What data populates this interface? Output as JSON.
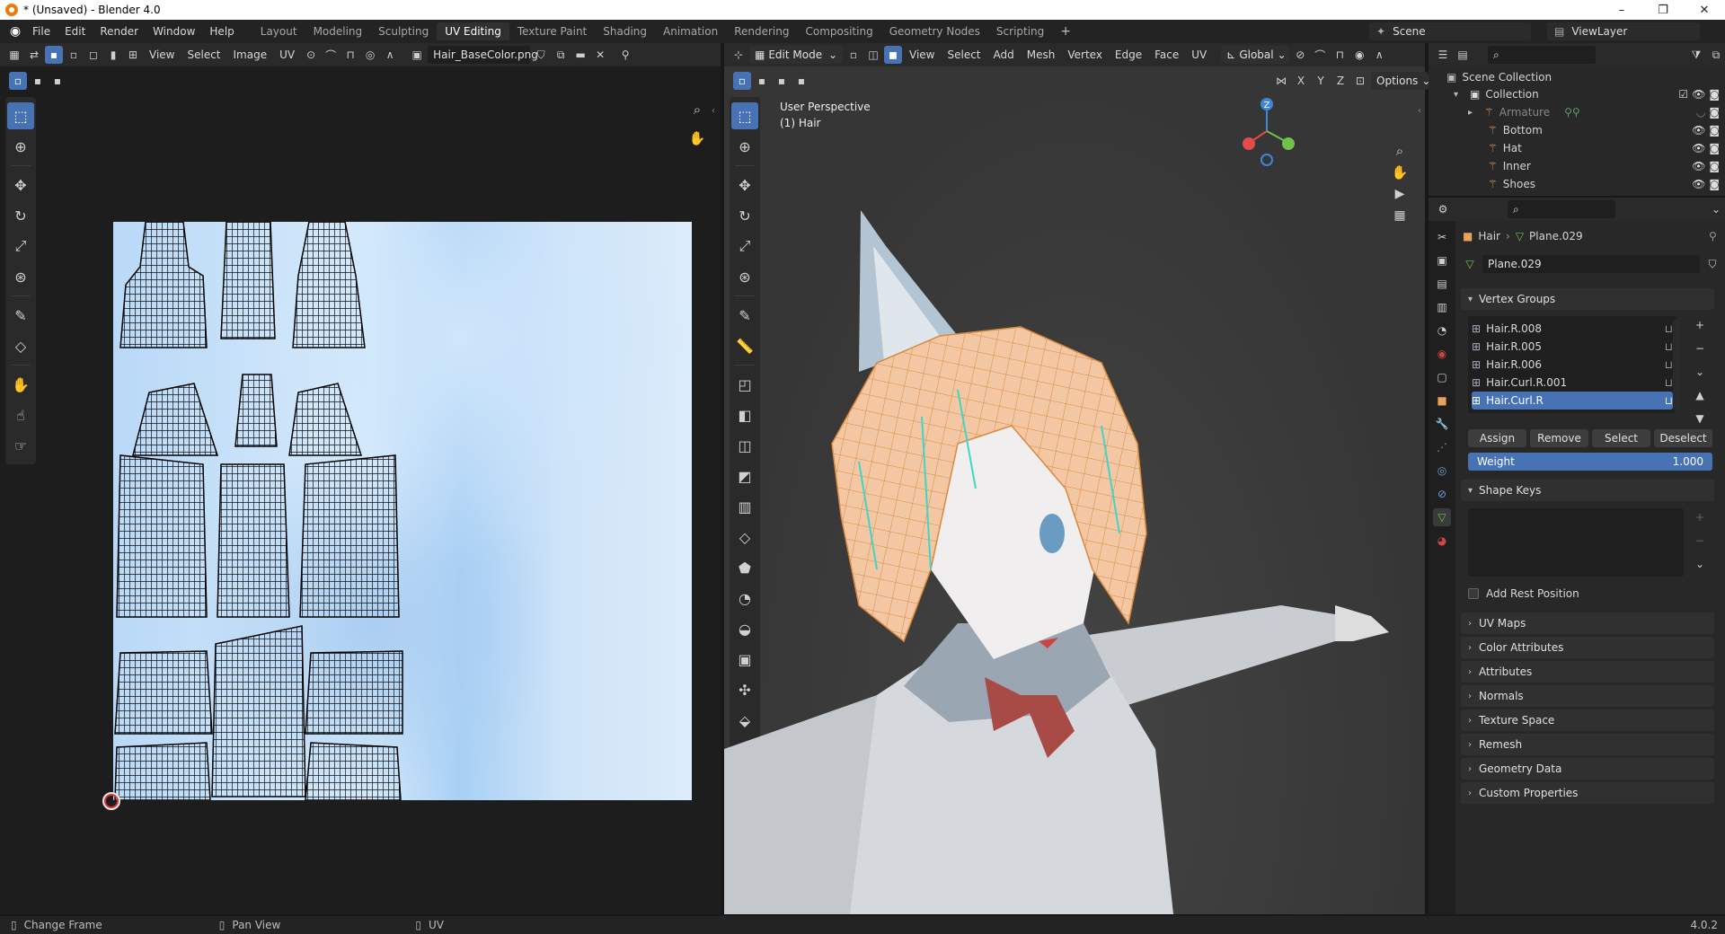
{
  "window": {
    "title": "* (Unsaved) - Blender 4.0",
    "minimize": "–",
    "maximize": "❐",
    "close": "✕"
  },
  "menu": [
    "File",
    "Edit",
    "Render",
    "Window",
    "Help"
  ],
  "workspaces": [
    "Layout",
    "Modeling",
    "Sculpting",
    "UV Editing",
    "Texture Paint",
    "Shading",
    "Animation",
    "Rendering",
    "Compositing",
    "Geometry Nodes",
    "Scripting"
  ],
  "active_workspace": "UV Editing",
  "scene": {
    "name": "Scene",
    "view_layer": "ViewLayer"
  },
  "uv_editor": {
    "menus": [
      "View",
      "Select",
      "Image",
      "UV"
    ],
    "image_name": "Hair_BaseColor.png"
  },
  "viewport": {
    "mode": "Edit Mode",
    "menus": [
      "View",
      "Select",
      "Add",
      "Mesh",
      "Vertex",
      "Edge",
      "Face",
      "UV"
    ],
    "transform_orientation": "Global",
    "axes": [
      "X",
      "Y",
      "Z"
    ],
    "options_label": "Options",
    "overlay_line1": "User Perspective",
    "overlay_line2": "(1) Hair",
    "gizmo": {
      "z": "Z",
      "colors": {
        "x": "#e24b4b",
        "y": "#6ec34a",
        "z": "#3f86d6"
      }
    }
  },
  "outliner": {
    "root": "Scene Collection",
    "collection": "Collection",
    "items": [
      "Armature",
      "Bottom",
      "Hat",
      "Inner",
      "Shoes"
    ]
  },
  "properties": {
    "breadcrumb_object": "Hair",
    "breadcrumb_data": "Plane.029",
    "mesh_name": "Plane.029",
    "vertex_groups": {
      "title": "Vertex Groups",
      "items": [
        "Hair.R.008",
        "Hair.R.005",
        "Hair.R.006",
        "Hair.Curl.R.001",
        "Hair.Curl.R"
      ],
      "selected": "Hair.Curl.R",
      "buttons": [
        "Assign",
        "Remove",
        "Select",
        "Deselect"
      ],
      "weight_label": "Weight",
      "weight_value": "1.000"
    },
    "shape_keys": {
      "title": "Shape Keys",
      "add_rest_position": "Add Rest Position"
    },
    "collapsed_panels": [
      "UV Maps",
      "Color Attributes",
      "Attributes",
      "Normals",
      "Texture Space",
      "Remesh",
      "Geometry Data",
      "Custom Properties"
    ]
  },
  "status": {
    "left": "Change Frame",
    "middle": "Pan View",
    "right": "UV",
    "version": "4.0.2"
  },
  "accent": "#4772b3"
}
